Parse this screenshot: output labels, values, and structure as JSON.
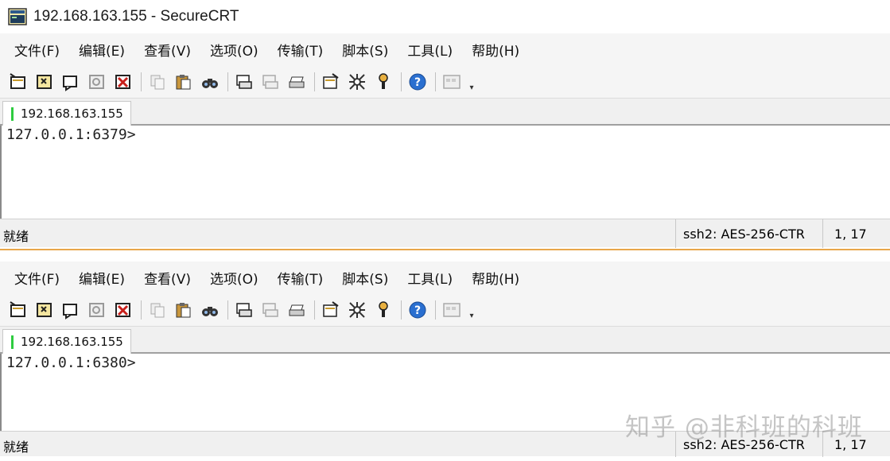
{
  "window": {
    "title": "192.168.163.155 - SecureCRT"
  },
  "menu": [
    "文件(F)",
    "编辑(E)",
    "查看(V)",
    "选项(O)",
    "传输(T)",
    "脚本(S)",
    "工具(L)",
    "帮助(H)"
  ],
  "toolbar": {
    "icons": [
      "connect-icon",
      "quick-connect-icon",
      "connect-in-tab-icon",
      "reconnect-icon",
      "disconnect-icon",
      "copy-icon",
      "paste-icon",
      "find-icon",
      "print-setup-icon",
      "print-icon",
      "print-screen-icon",
      "session-options-icon",
      "global-options-icon",
      "keymap-icon",
      "help-icon",
      "keyboard-icon"
    ]
  },
  "sessions": [
    {
      "tab_label": "192.168.163.155",
      "prompt": "127.0.0.1:6379>",
      "status": "就绪",
      "cipher": "ssh2: AES-256-CTR",
      "position": "1,  17"
    },
    {
      "tab_label": "192.168.163.155",
      "prompt": "127.0.0.1:6380>",
      "status": "就绪",
      "cipher": "ssh2: AES-256-CTR",
      "position": "1,  17"
    }
  ],
  "watermark": "知乎 @非科班的科班",
  "colors": {
    "tab_indicator": "#2ecc40",
    "divider": "#e8a64a"
  }
}
